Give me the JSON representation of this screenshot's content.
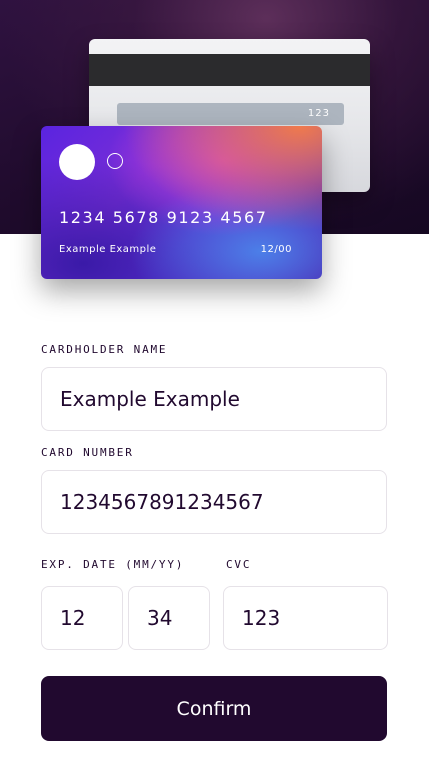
{
  "card_back": {
    "cvc": "123"
  },
  "card_front": {
    "number": "1234 5678 9123 4567",
    "holder": "Example Example",
    "expiry": "12/00"
  },
  "form": {
    "cardholder_label": "CARDHOLDER NAME",
    "cardholder_value": "Example Example",
    "number_label": "CARD NUMBER",
    "number_value": "1234567891234567",
    "exp_label": "EXP. DATE (MM/YY)",
    "exp_month_value": "12",
    "exp_year_value": "34",
    "cvc_label": "CVC",
    "cvc_value": "123",
    "confirm_label": "Confirm"
  },
  "colors": {
    "brand_dark": "#21092f",
    "field_border": "#e6e2e8",
    "card_gradient": [
      "#5a24e0",
      "#c23fd8",
      "#f07a4c",
      "#4c7fe8"
    ]
  }
}
